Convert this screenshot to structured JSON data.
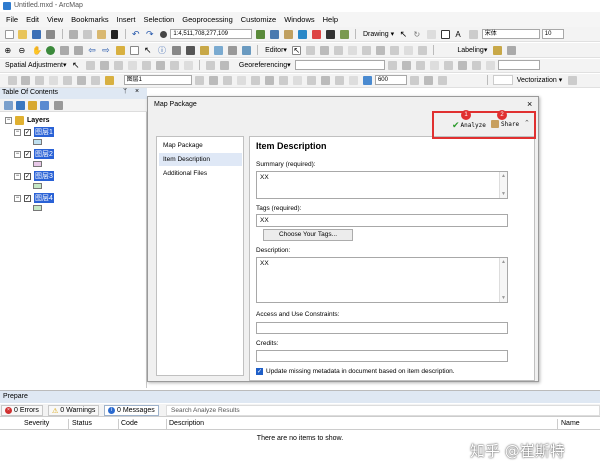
{
  "window": {
    "title": "Untitled.mxd - ArcMap"
  },
  "menu": [
    "File",
    "Edit",
    "View",
    "Bookmarks",
    "Insert",
    "Selection",
    "Geoprocessing",
    "Customize",
    "Windows",
    "Help"
  ],
  "toolbar": {
    "scale": "1:4,511,708,277,109",
    "drawing_label": "Drawing ▾",
    "font_name": "宋体",
    "font_size": "10",
    "editor_label": "Editor▾",
    "labeling_label": "Labeling▾",
    "spatial_adjustment": "Spatial Adjustment▾",
    "georeferencing": "Georeferencing▾",
    "layer_combo": "图层1",
    "resolution": "600",
    "vectorization": "Vectorization ▾"
  },
  "toc": {
    "title": "Table Of Contents",
    "root": "Layers",
    "layers": [
      {
        "name": "图层1",
        "swatch": "#bfe0f0"
      },
      {
        "name": "图层2",
        "swatch": "#e8c8e8"
      },
      {
        "name": "图层3",
        "swatch": "#c6e8c6"
      },
      {
        "name": "图层4",
        "swatch": "#c6e8c6"
      }
    ]
  },
  "dialog": {
    "title": "Map Package",
    "analyze_label": "Analyze",
    "share_label": "Share",
    "nav": [
      "Map Package",
      "Item Description",
      "Additional Files"
    ],
    "heading": "Item Description",
    "summary_label": "Summary (required):",
    "summary_value": "XX",
    "tags_label": "Tags (required):",
    "tags_value": "XX",
    "choose_tags": "Choose Your Tags...",
    "description_label": "Description:",
    "description_value": "XX",
    "constraints_label": "Access and Use Constraints:",
    "credits_label": "Credits:",
    "update_metadata": "Update missing metadata in document based on item description."
  },
  "annotation": {
    "step1": "1",
    "step2": "2"
  },
  "prepare": {
    "title": "Prepare",
    "tabs": [
      "0 Errors",
      "0 Warnings",
      "0 Messages"
    ],
    "search_label": "Search Analyze Results",
    "columns": [
      "Severity",
      "Status",
      "Code",
      "Description",
      "Name"
    ],
    "empty": "There are no items to show."
  },
  "watermark": "知乎 @崔斯特"
}
